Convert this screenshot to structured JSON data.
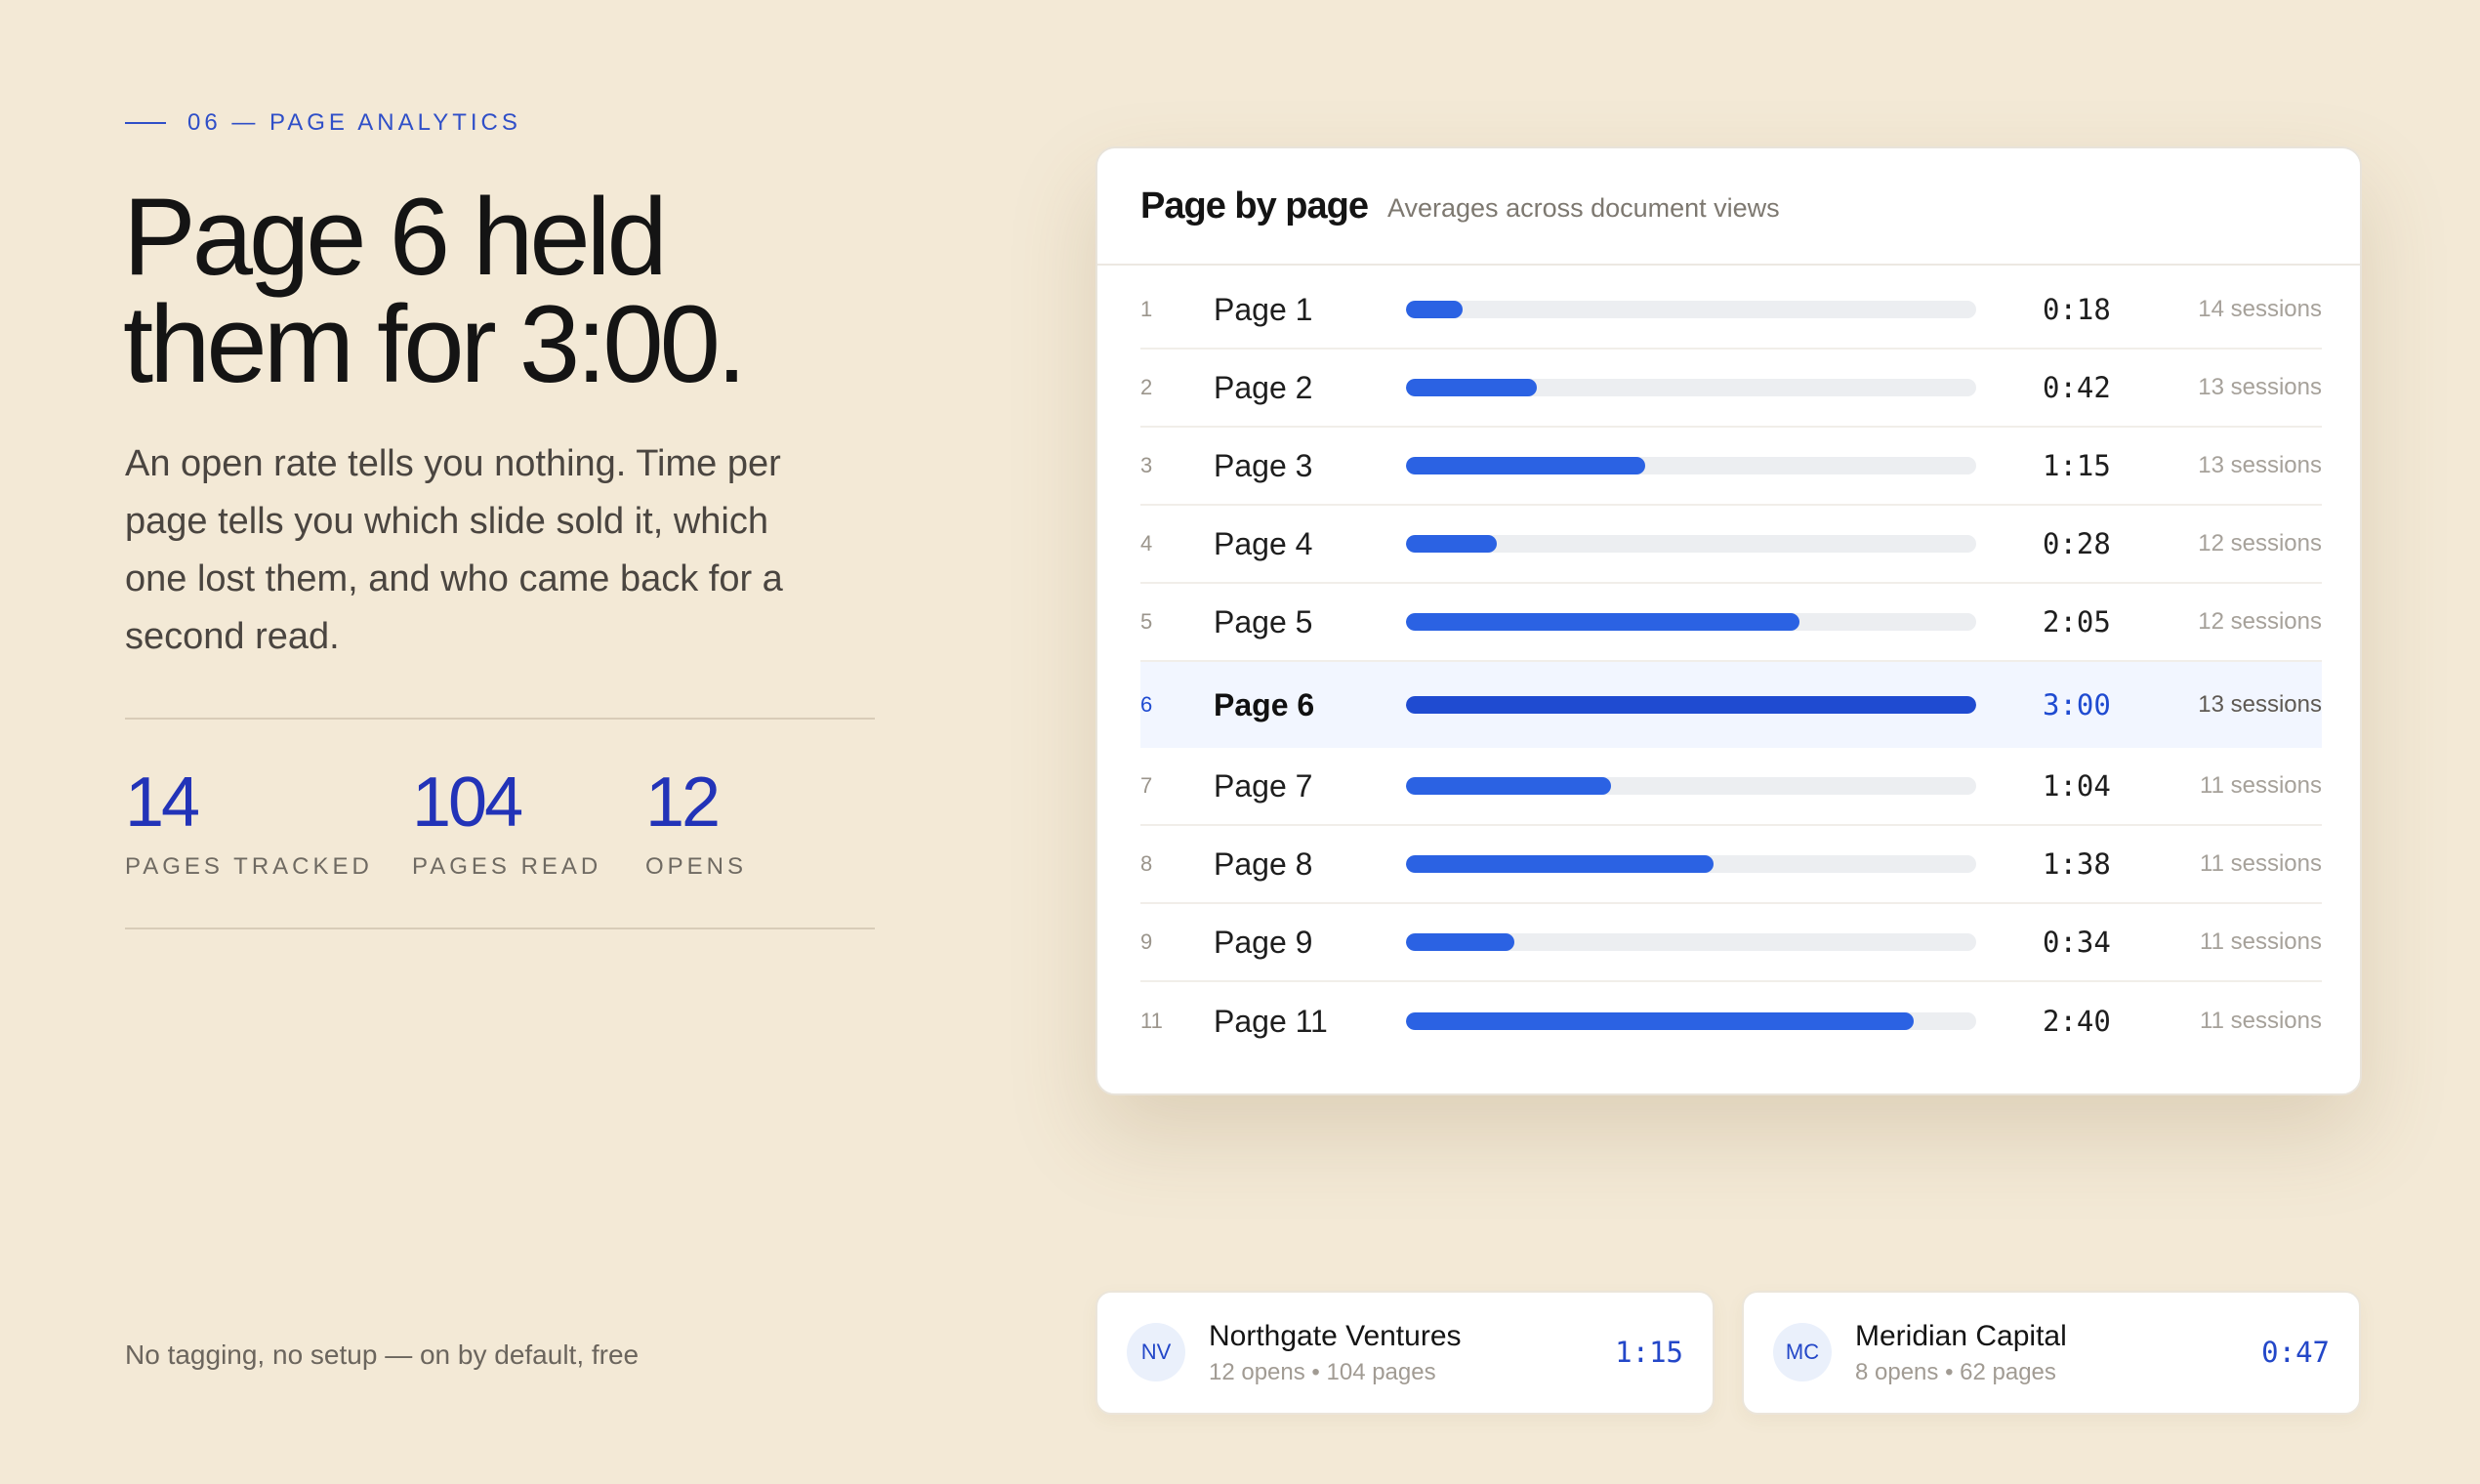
{
  "eyebrow": "06 — PAGE ANALYTICS",
  "headline_line1": "Page 6 held",
  "headline_line2": "them for 3:00.",
  "body": "An open rate tells you nothing. Time per page tells you which slide sold it, which one lost them, and who came back for a second read.",
  "stats": [
    {
      "value": "14",
      "label": "PAGES TRACKED"
    },
    {
      "value": "104",
      "label": "PAGES READ"
    },
    {
      "value": "12",
      "label": "OPENS"
    }
  ],
  "footnote": "No tagging, no setup — on by default, free",
  "card": {
    "title": "Page by page",
    "subtitle": "Averages across document views",
    "rows": [
      {
        "index": "1",
        "name": "Page 1",
        "time": "0:18",
        "sessions": "14 sessions",
        "progress": 0.1,
        "highlight": false
      },
      {
        "index": "2",
        "name": "Page 2",
        "time": "0:42",
        "sessions": "13 sessions",
        "progress": 0.23,
        "highlight": false
      },
      {
        "index": "3",
        "name": "Page 3",
        "time": "1:15",
        "sessions": "13 sessions",
        "progress": 0.42,
        "highlight": false
      },
      {
        "index": "4",
        "name": "Page 4",
        "time": "0:28",
        "sessions": "12 sessions",
        "progress": 0.16,
        "highlight": false
      },
      {
        "index": "5",
        "name": "Page 5",
        "time": "2:05",
        "sessions": "12 sessions",
        "progress": 0.69,
        "highlight": false
      },
      {
        "index": "6",
        "name": "Page 6",
        "time": "3:00",
        "sessions": "13 sessions",
        "progress": 1.0,
        "highlight": true
      },
      {
        "index": "7",
        "name": "Page 7",
        "time": "1:04",
        "sessions": "11 sessions",
        "progress": 0.36,
        "highlight": false
      },
      {
        "index": "8",
        "name": "Page 8",
        "time": "1:38",
        "sessions": "11 sessions",
        "progress": 0.54,
        "highlight": false
      },
      {
        "index": "9",
        "name": "Page 9",
        "time": "0:34",
        "sessions": "11 sessions",
        "progress": 0.19,
        "highlight": false
      },
      {
        "index": "11",
        "name": "Page 11",
        "time": "2:40",
        "sessions": "11 sessions",
        "progress": 0.89,
        "highlight": false
      }
    ]
  },
  "investors": [
    {
      "initials": "NV",
      "name": "Northgate Ventures",
      "meta": "12 opens • 104 pages",
      "time": "1:15"
    },
    {
      "initials": "MC",
      "name": "Meridian Capital",
      "meta": "8 opens • 62 pages",
      "time": "0:47"
    }
  ],
  "colors": {
    "background": "#f3e9d6",
    "accent": "#2233b8",
    "bar": "#2b62e3",
    "bar_highlight": "#1f4bd1",
    "track": "#eceef1"
  }
}
